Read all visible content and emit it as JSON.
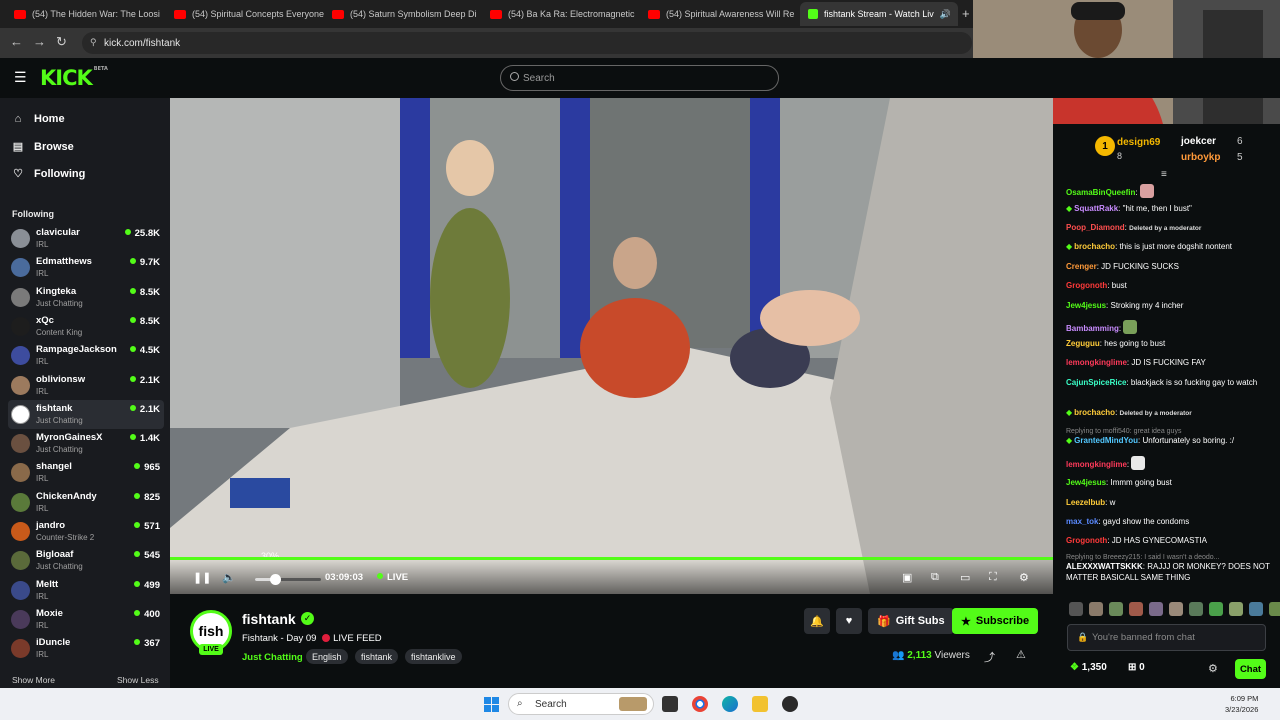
{
  "browser": {
    "tabs": [
      {
        "title": "(54) The Hidden War: The Loosi",
        "kind": "youtube"
      },
      {
        "title": "(54) Spiritual Concepts Everyone",
        "kind": "youtube"
      },
      {
        "title": "(54) Saturn Symbolism Deep Di",
        "kind": "youtube"
      },
      {
        "title": "(54) Ba Ka Ra: Electromagnetic",
        "kind": "youtube"
      },
      {
        "title": "(54) Spiritual Awareness Will Re",
        "kind": "youtube"
      },
      {
        "title": "fishtank Stream - Watch Liv",
        "kind": "kick",
        "active": true
      }
    ],
    "url": "kick.com/fishtank"
  },
  "header": {
    "logo": "KICK",
    "logo_sup": "BETA",
    "search_placeholder": "Search"
  },
  "sidebar": {
    "nav": [
      {
        "label": "Home",
        "icon": "home-icon"
      },
      {
        "label": "Browse",
        "icon": "browse-icon"
      },
      {
        "label": "Following",
        "icon": "heart-icon"
      }
    ],
    "following_heading": "Following",
    "channels": [
      {
        "name": "clavicular",
        "category": "IRL",
        "viewers": "25.8K",
        "color": "#8a8f96"
      },
      {
        "name": "Edmatthews",
        "category": "IRL",
        "viewers": "9.7K",
        "color": "#4a6b9c"
      },
      {
        "name": "Kingteka",
        "category": "Just Chatting",
        "viewers": "8.5K",
        "color": "#7a7a7a"
      },
      {
        "name": "xQc",
        "category": "Content King",
        "viewers": "8.5K",
        "color": "#1d1d1d"
      },
      {
        "name": "RampageJackson",
        "category": "IRL",
        "viewers": "4.5K",
        "color": "#3d4c9e"
      },
      {
        "name": "oblivionsw",
        "category": "IRL",
        "viewers": "2.1K",
        "color": "#9c7a5e"
      },
      {
        "name": "fishtank",
        "category": "Just Chatting",
        "viewers": "2.1K",
        "color": "#ffffff",
        "selected": true
      },
      {
        "name": "MyronGainesX",
        "category": "Just Chatting",
        "viewers": "1.4K",
        "color": "#6a5040"
      },
      {
        "name": "shangel",
        "category": "IRL",
        "viewers": "965",
        "color": "#8a6a4a"
      },
      {
        "name": "ChickenAndy",
        "category": "IRL",
        "viewers": "825",
        "color": "#5a7a3a"
      },
      {
        "name": "jandro",
        "category": "Counter-Strike 2",
        "viewers": "571",
        "color": "#c85a1a"
      },
      {
        "name": "Bigloaaf",
        "category": "Just Chatting",
        "viewers": "545",
        "color": "#5a6a3a"
      },
      {
        "name": "Meltt",
        "category": "IRL",
        "viewers": "499",
        "color": "#3a4a8a"
      },
      {
        "name": "Moxie",
        "category": "IRL",
        "viewers": "400",
        "color": "#4a3a5a"
      },
      {
        "name": "iDuncle",
        "category": "IRL",
        "viewers": "367",
        "color": "#7a3a2a"
      }
    ],
    "show_more": "Show More",
    "show_less": "Show Less"
  },
  "player": {
    "volume_percent": 30,
    "volume_tooltip": "30%",
    "time": "03:09:03",
    "live_label": "LIVE"
  },
  "stream": {
    "avatar_text": "fish",
    "avatar_live": "LIVE",
    "channel": "fishtank",
    "title_text": "Fishtank - Day 09",
    "title_suffix": "LIVE FEED",
    "category": "Just Chatting",
    "tags": [
      "English",
      "fishtank",
      "fishtanklive"
    ],
    "gift_subs": "Gift Subs",
    "subscribe": "Subscribe",
    "viewers_count": "2,113",
    "viewers_label": "Viewers"
  },
  "chat": {
    "leaders": [
      {
        "name": "design69",
        "count": "8",
        "rank": "1"
      },
      {
        "name": "joekcer",
        "count": "6"
      },
      {
        "name": "urboykp",
        "count": "5"
      }
    ],
    "messages": [
      {
        "user": "OsamaBinQueefin",
        "text": "",
        "color": "#53fc18",
        "emote": "#d9a0a0"
      },
      {
        "user": "SquattRakk",
        "text": "\"hit me, then I bust\"",
        "color": "#c98cff",
        "badge": true
      },
      {
        "user": "Poop_Diamond",
        "text": "Deleted by a moderator",
        "color": "#ff4f4f",
        "mod": true
      },
      {
        "user": "brochacho",
        "text": "this is just more dogshit nontent",
        "color": "#ffcc3a",
        "badge": true
      },
      {
        "user": "Crenger",
        "text": "JD FUCKING SUCKS",
        "color": "#ff9a3a"
      },
      {
        "user": "Grogonoth",
        "text": "bust",
        "color": "#ff3a3a"
      },
      {
        "user": "Jew4jesus",
        "text": "Stroking my 4 incher",
        "color": "#53fc18"
      },
      {
        "user": "Bambamming",
        "text": "",
        "color": "#c98cff",
        "emote": "#7aa05a"
      },
      {
        "user": "Zeguguu",
        "text": "hes going to bust",
        "color": "#ffcc3a"
      },
      {
        "user": "lemongkinglime",
        "text": "JD IS FUCKING FAY",
        "color": "#ff3a5a"
      },
      {
        "user": "CajunSpiceRice",
        "text": "blackjack is so fucking gay to watch",
        "color": "#3affc8"
      },
      {
        "user": "brochacho",
        "text": "Deleted by a moderator",
        "color": "#ffcc3a",
        "badge": true,
        "mod": true
      },
      {
        "user": "GrantedMindYou",
        "text": "Unfortunately so boring. :/",
        "color": "#53c8ff",
        "badge": true,
        "reply": "Replying to moffi540:  great idea guys"
      },
      {
        "user": "lemongkinglime",
        "text": "",
        "color": "#ff3a5a",
        "emote": "#e8e8e8"
      },
      {
        "user": "Jew4jesus",
        "text": "Immm going bust",
        "color": "#53fc18"
      },
      {
        "user": "Leezelbub",
        "text": "w",
        "color": "#ffcc3a"
      },
      {
        "user": "max_tok",
        "text": "gayd show the condoms",
        "color": "#5a8aff"
      },
      {
        "user": "Grogonoth",
        "text": "JD HAS GYNECOMASTIA",
        "color": "#ff3a3a"
      },
      {
        "user": "ALEXXXWATTSKKK",
        "text": "RAJJJ OR MONKEY? DOES NOT MATTER BASICALL SAME THING",
        "color": "#ffffff",
        "reply": "Replying to Breeezy215: I said I wasn't a deodo..."
      }
    ],
    "banned_placeholder": "You're banned from chat",
    "points": "1,350",
    "drops": "0",
    "chat_button": "Chat"
  },
  "taskbar": {
    "search": "Search",
    "time": "6:09 PM",
    "date": "3/23/2026"
  },
  "colors": {
    "accent": "#53fc18",
    "background": "#0b0e0f",
    "sidebar": "#191b1f"
  }
}
